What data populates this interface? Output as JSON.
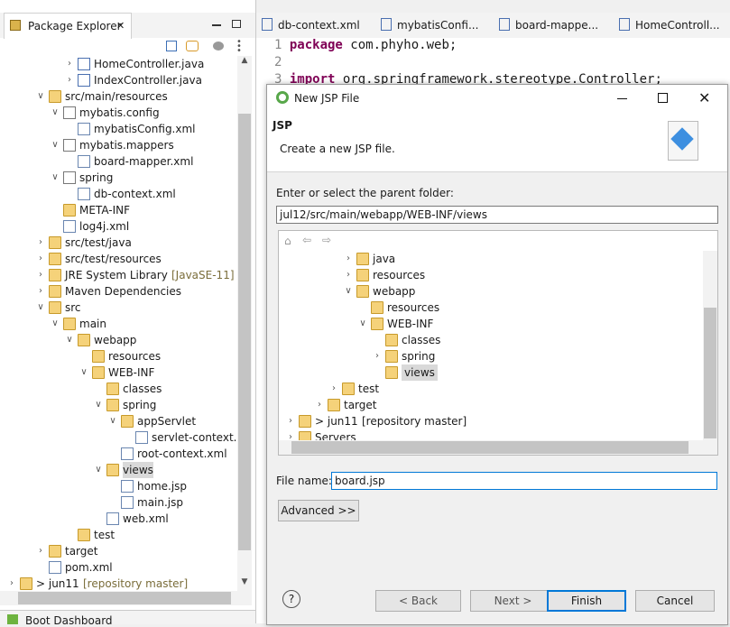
{
  "package_explorer": {
    "title": "Package Explorer",
    "close": "✕",
    "tree": [
      {
        "label": "HomeController.java",
        "icon": "java-file-icon",
        "twisty": ">"
      },
      {
        "label": "IndexController.java",
        "icon": "java-file-icon",
        "twisty": ">"
      },
      {
        "label": "src/main/resources",
        "icon": "source-folder-icon",
        "twisty": "v"
      },
      {
        "label": "mybatis.config",
        "icon": "package-icon",
        "twisty": "v"
      },
      {
        "label": "mybatisConfig.xml",
        "icon": "xml-file-icon",
        "twisty": ""
      },
      {
        "label": "mybatis.mappers",
        "icon": "package-icon",
        "twisty": "v"
      },
      {
        "label": "board-mapper.xml",
        "icon": "xml-file-icon",
        "twisty": ""
      },
      {
        "label": "spring",
        "icon": "package-icon",
        "twisty": "v"
      },
      {
        "label": "db-context.xml",
        "icon": "spring-xml-icon",
        "twisty": ""
      },
      {
        "label": "META-INF",
        "icon": "folder-icon",
        "twisty": ""
      },
      {
        "label": "log4j.xml",
        "icon": "xml-file-icon",
        "twisty": ""
      },
      {
        "label": "src/test/java",
        "icon": "source-folder-icon",
        "twisty": ">"
      },
      {
        "label": "src/test/resources",
        "icon": "source-folder-icon",
        "twisty": ">"
      },
      {
        "label": "JRE System Library",
        "suffix": "[JavaSE-11]",
        "icon": "library-icon",
        "twisty": ">"
      },
      {
        "label": "Maven Dependencies",
        "icon": "library-icon",
        "twisty": ">"
      },
      {
        "label": "src",
        "icon": "folder-icon",
        "twisty": "v"
      },
      {
        "label": "main",
        "icon": "folder-icon",
        "twisty": "v"
      },
      {
        "label": "webapp",
        "icon": "folder-icon",
        "twisty": "v"
      },
      {
        "label": "resources",
        "icon": "folder-icon",
        "twisty": ""
      },
      {
        "label": "WEB-INF",
        "icon": "folder-icon",
        "twisty": "v"
      },
      {
        "label": "classes",
        "icon": "folder-icon",
        "twisty": ""
      },
      {
        "label": "spring",
        "icon": "folder-icon",
        "twisty": "v"
      },
      {
        "label": "appServlet",
        "icon": "folder-icon",
        "twisty": "v"
      },
      {
        "label": "servlet-context.xml",
        "icon": "spring-xml-icon",
        "twisty": ""
      },
      {
        "label": "root-context.xml",
        "icon": "spring-xml-icon",
        "twisty": ""
      },
      {
        "label": "views",
        "icon": "folder-icon",
        "twisty": "v"
      },
      {
        "label": "home.jsp",
        "icon": "jsp-file-icon",
        "twisty": ""
      },
      {
        "label": "main.jsp",
        "icon": "jsp-file-icon",
        "twisty": ""
      },
      {
        "label": "web.xml",
        "icon": "xml-file-icon",
        "twisty": ""
      },
      {
        "label": "test",
        "icon": "folder-icon",
        "twisty": ""
      },
      {
        "label": "target",
        "icon": "folder-icon",
        "twisty": ">"
      },
      {
        "label": "pom.xml",
        "icon": "maven-file-icon",
        "twisty": ""
      },
      {
        "label": "> jun11",
        "suffix": "[repository master]",
        "icon": "project-icon",
        "twisty": ">"
      }
    ],
    "bottom_tab": "Boot Dashboard"
  },
  "editor": {
    "tabs": [
      "db-context.xml",
      "mybatisConfi...",
      "board-mappe...",
      "HomeControll..."
    ],
    "lines": [
      {
        "n": "1",
        "kw": "package",
        "rest": " com.phyho.web;"
      },
      {
        "n": "2",
        "kw": "",
        "rest": ""
      },
      {
        "n": "3",
        "kw": "import",
        "rest": " org.springframework.stereotype.Controller;"
      }
    ]
  },
  "dialog": {
    "title": "New JSP File",
    "banner_title": "JSP",
    "banner_desc": "Create a new JSP file.",
    "folder_label": "Enter or select the parent folder:",
    "folder_value": "jul12/src/main/webapp/WEB-INF/views",
    "tree": [
      {
        "label": "java",
        "twisty": ">"
      },
      {
        "label": "resources",
        "twisty": ">"
      },
      {
        "label": "webapp",
        "twisty": "v"
      },
      {
        "label": "resources",
        "twisty": ""
      },
      {
        "label": "WEB-INF",
        "twisty": "v"
      },
      {
        "label": "classes",
        "twisty": ""
      },
      {
        "label": "spring",
        "twisty": ">"
      },
      {
        "label": "views",
        "twisty": "",
        "selected": true
      },
      {
        "label": "test",
        "twisty": ">"
      },
      {
        "label": "target",
        "twisty": ">"
      },
      {
        "label": "> jun11",
        "suffix": "[repository master]",
        "twisty": ">"
      },
      {
        "label": "Servers",
        "twisty": ">"
      }
    ],
    "filename_label": "File name:",
    "filename_value": "board.jsp",
    "advanced_label": "Advanced >>",
    "help": "?",
    "back_label": "< Back",
    "next_label": "Next >",
    "finish_label": "Finish",
    "cancel_label": "Cancel"
  },
  "colors": {
    "selection": "#d9d9d9",
    "focus": "#0078d7",
    "keyword": "#7f0055"
  }
}
